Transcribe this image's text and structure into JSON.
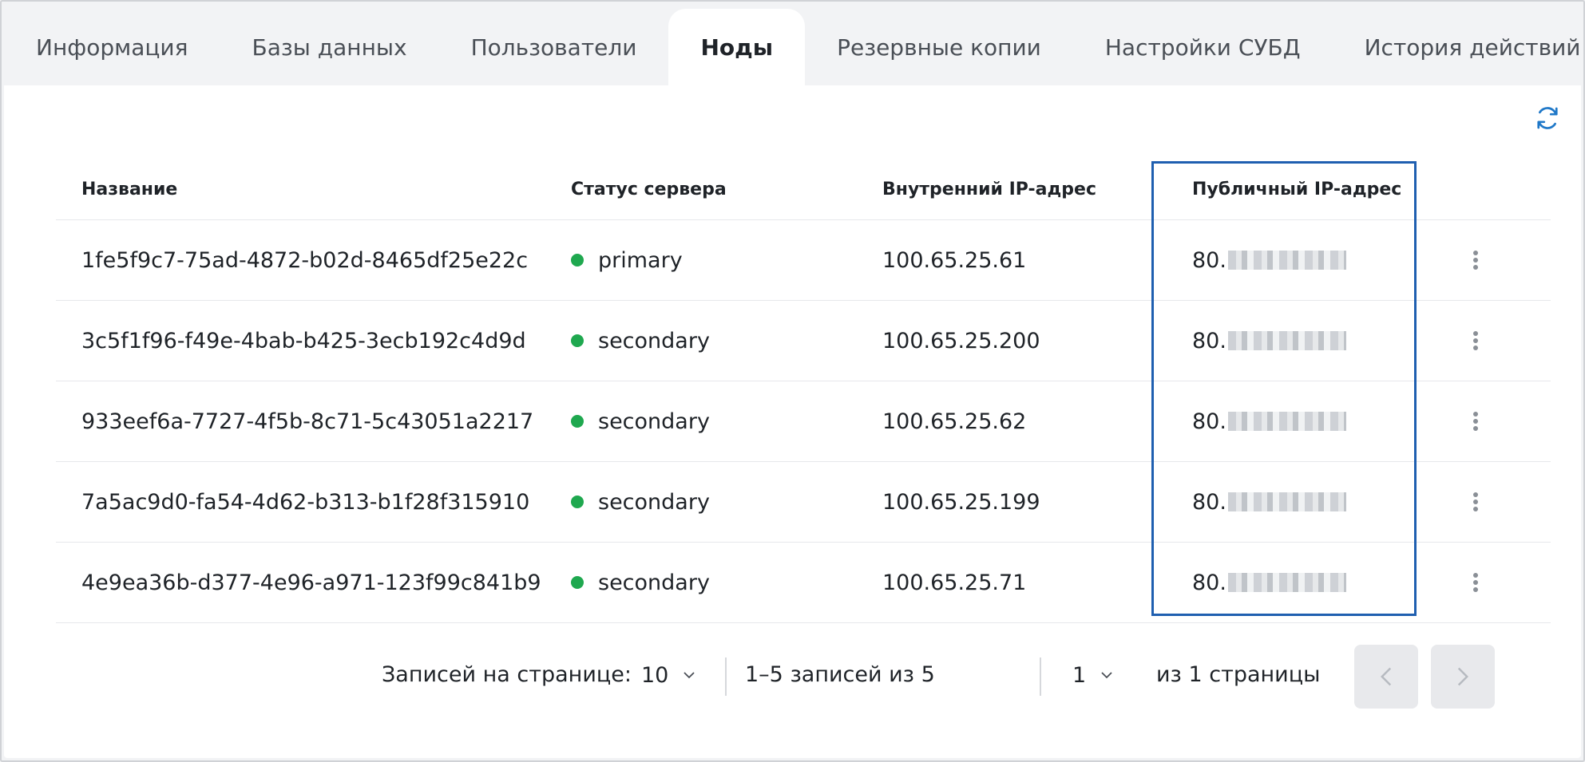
{
  "tabs": [
    {
      "label": "Информация",
      "active": false
    },
    {
      "label": "Базы данных",
      "active": false
    },
    {
      "label": "Пользователи",
      "active": false
    },
    {
      "label": "Ноды",
      "active": true
    },
    {
      "label": "Резервные копии",
      "active": false
    },
    {
      "label": "Настройки СУБД",
      "active": false
    },
    {
      "label": "История действий",
      "active": false
    }
  ],
  "table": {
    "headers": {
      "name": "Название",
      "status": "Статус сервера",
      "inner_ip": "Внутренний IP-адрес",
      "public_ip": "Публичный IP-адрес"
    },
    "rows": [
      {
        "name": "1fe5f9c7-75ad-4872-b02d-8465df25e22c",
        "status": "primary",
        "inner_ip": "100.65.25.61",
        "public_ip": "80."
      },
      {
        "name": "3c5f1f96-f49e-4bab-b425-3ecb192c4d9d",
        "status": "secondary",
        "inner_ip": "100.65.25.200",
        "public_ip": "80."
      },
      {
        "name": "933eef6a-7727-4f5b-8c71-5c43051a2217",
        "status": "secondary",
        "inner_ip": "100.65.25.62",
        "public_ip": "80."
      },
      {
        "name": "7a5ac9d0-fa54-4d62-b313-b1f28f315910",
        "status": "secondary",
        "inner_ip": "100.65.25.199",
        "public_ip": "80."
      },
      {
        "name": "4e9ea36b-d377-4e96-a971-123f99c841b9",
        "status": "secondary",
        "inner_ip": "100.65.25.71",
        "public_ip": "80."
      }
    ]
  },
  "pagination": {
    "per_page_label": "Записей на странице:",
    "per_page_value": "10",
    "range_text": "1–5 записей из 5",
    "page_value": "1",
    "pages_text": "из 1 страницы"
  },
  "colors": {
    "status_ok": "#1fa84f",
    "highlight": "#1f5fb0",
    "accent": "#1f78c8"
  },
  "icons": {
    "refresh": "refresh-icon",
    "row_menu": "more-vertical-icon",
    "chevron": "chevron-down-icon",
    "prev": "chevron-left-icon",
    "next": "chevron-right-icon"
  }
}
